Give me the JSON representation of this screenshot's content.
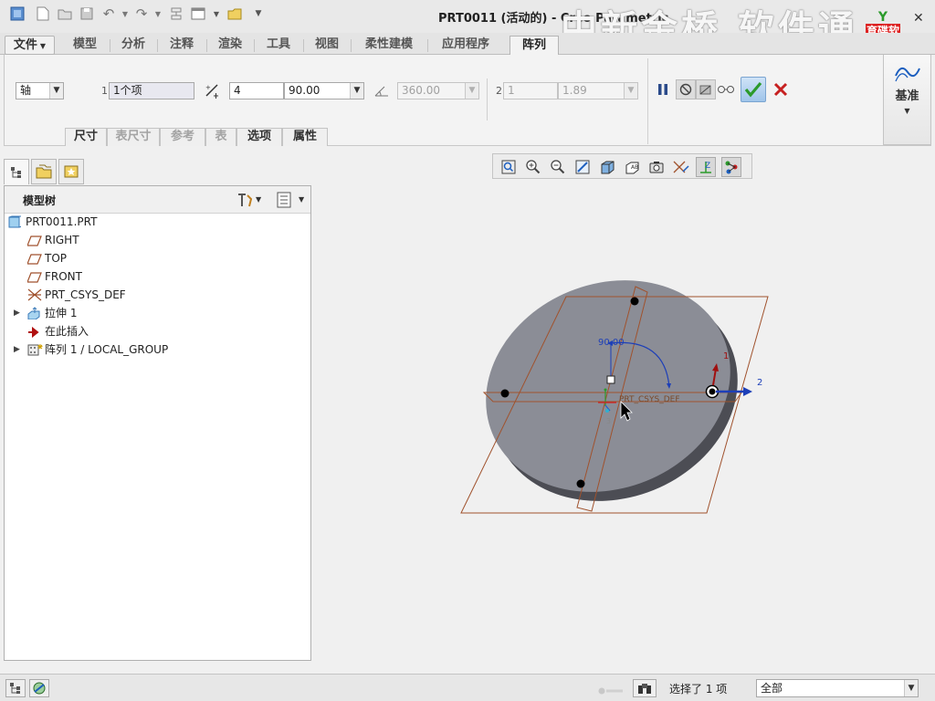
{
  "window": {
    "title": "PRT0011 (活动的) - Creo Parametric",
    "watermark": "中新金桥 软件通",
    "logo_text": "育碟软件",
    "help_icon": "?"
  },
  "menu": {
    "file_label": "文件",
    "tabs": [
      "模型",
      "分析",
      "注释",
      "渲染",
      "工具",
      "视图",
      "柔性建模",
      "应用程序",
      "阵列"
    ],
    "active_tab": "阵列"
  },
  "ribbon": {
    "pattern_type": "轴",
    "dir1_num": "1",
    "dir1_ref": "1个项",
    "dir1_count": "4",
    "dir1_angle": "90.00",
    "angle_extent": "360.00",
    "dir2_num": "2",
    "dir2_count": "1",
    "dir2_spacing": "1.89",
    "subtabs": [
      "尺寸",
      "表尺寸",
      "参考",
      "表",
      "选项",
      "属性"
    ],
    "subtabs_disabled": [
      false,
      true,
      true,
      true,
      false,
      false
    ],
    "datum_label": "基准"
  },
  "left_panel": {
    "tree_title": "模型树",
    "tree": [
      {
        "label": "PRT0011.PRT",
        "icon": "part-icon",
        "expandable": false,
        "indent": 0
      },
      {
        "label": "RIGHT",
        "icon": "datum-plane-icon",
        "expandable": false,
        "indent": 1
      },
      {
        "label": "TOP",
        "icon": "datum-plane-icon",
        "expandable": false,
        "indent": 1
      },
      {
        "label": "FRONT",
        "icon": "datum-plane-icon",
        "expandable": false,
        "indent": 1
      },
      {
        "label": "PRT_CSYS_DEF",
        "icon": "csys-icon",
        "expandable": false,
        "indent": 1
      },
      {
        "label": "拉伸 1",
        "icon": "extrude-icon",
        "expandable": true,
        "indent": 1
      },
      {
        "label": "在此插入",
        "icon": "insert-here-icon",
        "expandable": false,
        "indent": 1
      },
      {
        "label": "阵列 1 / LOCAL_GROUP",
        "icon": "pattern-icon",
        "expandable": true,
        "indent": 1
      }
    ]
  },
  "viewport": {
    "angle_dim": "90.00",
    "csys_label": "PRT_CSYS_DEF",
    "axis_label_1": "1",
    "axis_label_2": "2",
    "axis_label_3": "3"
  },
  "status": {
    "selection_text": "选择了 1 项",
    "filter_value": "全部"
  },
  "colors": {
    "accent_blue": "#1d5fbf",
    "disk_gray": "#8a8c95",
    "plane_brown": "#a05a2c",
    "check_green": "#2c9a2c",
    "cancel_red": "#cc2020"
  }
}
